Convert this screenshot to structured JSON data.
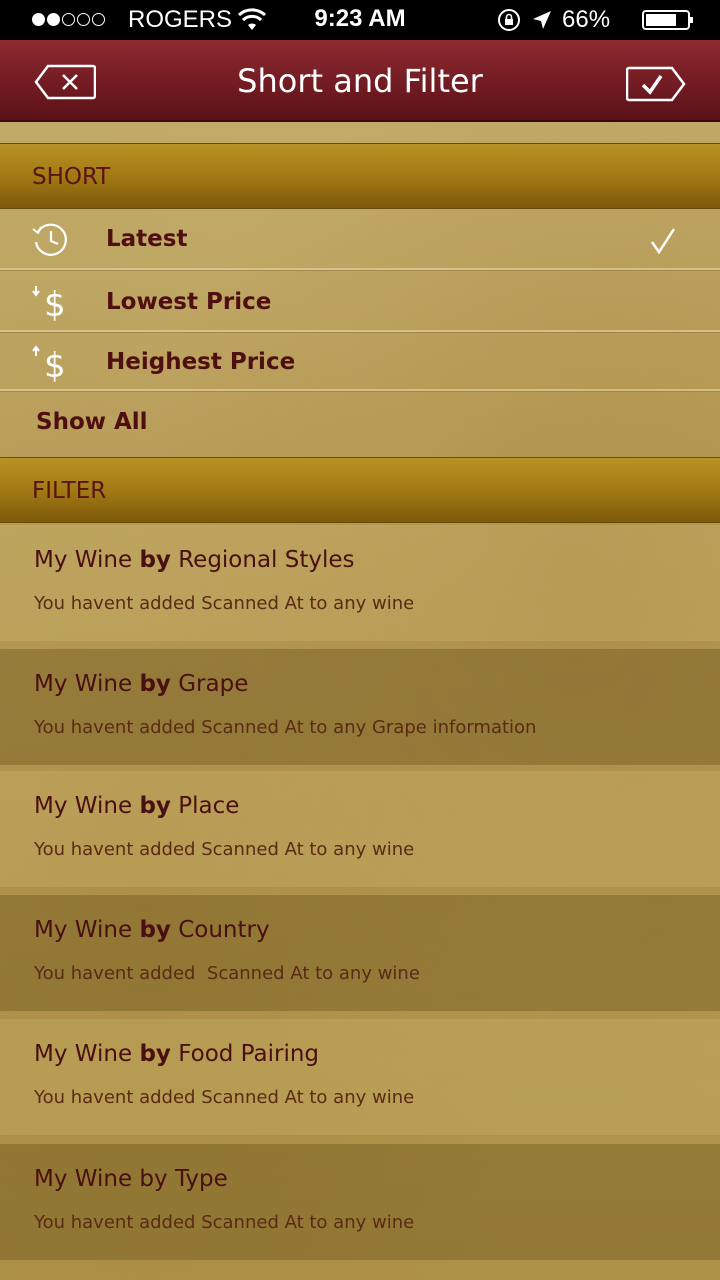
{
  "status_bar": {
    "signal_dots_filled": 2,
    "signal_dots_total": 5,
    "carrier": "ROGERS",
    "time": "9:23 AM",
    "battery_percent": "66%",
    "icons": [
      "wifi-icon",
      "orientation-lock-icon",
      "location-arrow-icon",
      "battery-icon"
    ]
  },
  "nav": {
    "title": "Short and Filter",
    "cancel_icon": "close-x-icon",
    "done_icon": "checkmark-icon"
  },
  "sort": {
    "header": "SHORT",
    "items": [
      {
        "label": "Latest",
        "icon": "clock-icon",
        "selected": true
      },
      {
        "label": "Lowest Price",
        "icon": "price-down-icon",
        "selected": false
      },
      {
        "label": "Heighest Price",
        "icon": "price-up-icon",
        "selected": false
      }
    ],
    "show_all": "Show All"
  },
  "filter": {
    "header": "FILTER",
    "items": [
      {
        "title_prefix": "My Wine ",
        "title_bold": "by",
        "title_suffix": " Regional Styles",
        "subtitle": "You havent added Scanned At to any wine"
      },
      {
        "title_prefix": "My Wine ",
        "title_bold": "by",
        "title_suffix": " Grape",
        "subtitle": "You havent added Scanned At to any Grape information"
      },
      {
        "title_prefix": "My Wine ",
        "title_bold": "by",
        "title_suffix": " Place",
        "subtitle": "You havent added Scanned At to any wine"
      },
      {
        "title_prefix": "My Wine ",
        "title_bold": "by",
        "title_suffix": " Country",
        "subtitle": "You havent added  Scanned At to any wine"
      },
      {
        "title_prefix": "My Wine ",
        "title_bold": "by",
        "title_suffix": " Food Pairing",
        "subtitle": "You havent added Scanned At to any wine"
      },
      {
        "title_prefix": "My Wine by Type",
        "title_bold": "",
        "title_suffix": "",
        "subtitle": "You havent added Scanned At to any wine"
      }
    ]
  },
  "colors": {
    "nav_bar": "#7a1f26",
    "section_header": "#a27a14",
    "label_text": "#4f0e10"
  }
}
